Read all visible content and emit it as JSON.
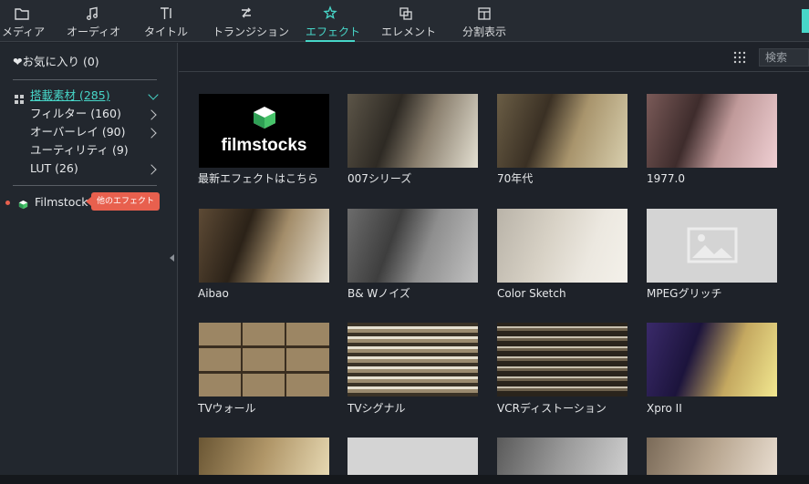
{
  "toolbar": {
    "tabs": [
      {
        "label": "メディア",
        "icon": "folder-icon"
      },
      {
        "label": "オーディオ",
        "icon": "music-note-icon"
      },
      {
        "label": "タイトル",
        "icon": "title-text-icon"
      },
      {
        "label": "トランジション",
        "icon": "transition-icon"
      },
      {
        "label": "エフェクト",
        "icon": "effects-icon",
        "active": true
      },
      {
        "label": "エレメント",
        "icon": "elements-icon"
      },
      {
        "label": "分割表示",
        "icon": "split-screen-icon"
      }
    ],
    "accent_color": "#47d6c8"
  },
  "sidebar": {
    "favorites": "❤お気に入り (0)",
    "builtin": "搭載素材 (285)",
    "items": [
      {
        "label": "フィルター (160)"
      },
      {
        "label": "オーバーレイ (90)"
      },
      {
        "label": "ユーティリティ (9)"
      },
      {
        "label": "LUT (26)"
      }
    ],
    "filmstock": "Filmstock",
    "badge": "他のエフェクト"
  },
  "main": {
    "search_placeholder": "検索",
    "effects": [
      {
        "caption": "最新エフェクトはこちら"
      },
      {
        "caption": "007シリーズ"
      },
      {
        "caption": "70年代"
      },
      {
        "caption": "1977.0"
      },
      {
        "caption": "Aibao"
      },
      {
        "caption": "B& Wノイズ"
      },
      {
        "caption": "Color Sketch"
      },
      {
        "caption": "MPEGグリッチ"
      },
      {
        "caption": "TVウォール"
      },
      {
        "caption": "TVシグナル"
      },
      {
        "caption": "VCRディストーション"
      },
      {
        "caption": "Xpro II"
      }
    ],
    "filmstocks_logo": "filmstocks"
  }
}
